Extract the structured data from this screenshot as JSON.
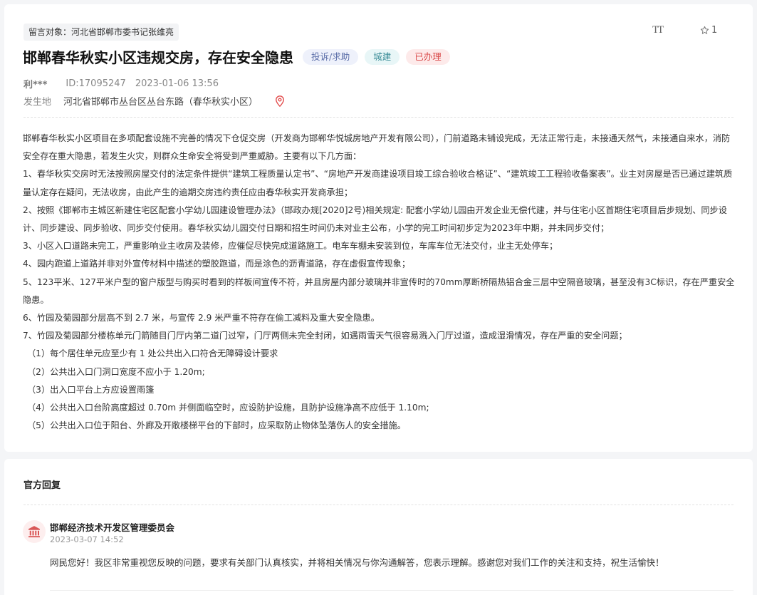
{
  "message": {
    "target_tag": "留言对象：河北省邯郸市委书记张维亮",
    "font_tool_label": "TT",
    "star_count": "1",
    "title": "邯郸春华秋实小区违规交房，存在安全隐患",
    "badges": [
      "投诉/求助",
      "城建",
      "已办理"
    ],
    "author": "利***",
    "post_id": "ID:17095247",
    "date": "2023-01-06 13:56",
    "location_label": "发生地",
    "location_value": "河北省邯郸市丛台区丛台东路（春华秋实小区）"
  },
  "content": {
    "paragraphs": [
      "邯郸春华秋实小区项目在多项配套设施不完善的情况下仓促交房（开发商为邯郸华悦城房地产开发有限公司），门前道路未铺设完成，无法正常行走，未接通天然气，未接通自来水，消防安全存在重大隐患，若发生火灾，则群众生命安全将受到严重威胁。主要有以下几方面：",
      "1、春华秋实交房时无法按照房屋交付的法定条件提供“建筑工程质量认定书”、“房地产开发商建设项目竣工综合验收合格证”、“建筑竣工工程验收备案表”。业主对房屋是否已通过建筑质量认定存在疑问，无法收房，由此产生的逾期交房违约责任应由春华秋实开发商承担；",
      "2、按照《邯郸市主城区新建住宅区配套小学幼儿园建设管理办法》（邯政办规[2020]2号)相关规定: 配套小学幼儿园由开发企业无偿代建，并与住宅小区首期住宅项目后步规划、同步设计、同步建设、同步验收、同步交付使用。春华秋实幼儿园交付日期和招生时间仍未对业主公布，小学的完工时间初步定为2023年中期，并未同步交付；",
      "3、小区入口道路未完工，严重影响业主收房及装修，应催促尽快完成道路施工。电车车棚未安装到位，车库车位无法交付，业主无处停车；",
      "4、园内跑道上道路并非对外宣传材料中描述的塑胶跑道，而是涂色的沥青道路，存在虚假宣传现象；",
      "5、123平米、127平米户型的窗户版型与购买时看到的样板间宣传不符，并且房屋内部分玻璃并非宣传时的70mm厚断桥隔热铝合金三层中空隔音玻璃，甚至没有3C标识，存在严重安全隐患。",
      "6、竹园及菊园部分层高不到 2.7 米，与宣传 2.9 米严重不符存在偷工减料及重大安全隐患。",
      "7、竹园及菊园部分楼栋单元门箭随目门厅内第二道门过窄，门厅两侧未完全封闭，如遇雨雪天气很容易溅入门厅过道，造成湿滑情况，存在严重的安全问题；"
    ],
    "sub_items": [
      "（1）每个居住单元应至少有 1 处公共出入口符合无障碍设计要求",
      "（2）公共出入口门洞口宽度不应小于 1.20m;",
      "（3）出入口平台上方应设置雨篷",
      "（4）公共出入口台阶高度超过 0.70m 并侧面临空时，应设防护设施，且防护设施净高不应低于 1.10m;",
      "（5）公共出入口位于阳台、外廊及开敞楼梯平台的下部时，应采取防止物体坠落伤人的安全措施。"
    ]
  },
  "reply": {
    "heading": "官方回复",
    "org_name": "邯郸经济技术开发区管理委员会",
    "date": "2023-03-07 14:52",
    "text": "网民您好！我区非常重视您反映的问题，要求有关部门认真核实，并将相关情况与你沟通解答，您表示理解。感谢您对我们工作的关注和支持，祝生活愉快！"
  },
  "colors": {
    "badge_blue": "#5b6ea8",
    "badge_cyan": "#3a8c97",
    "badge_red": "#d94a4a",
    "pin": "#e24a4a",
    "org_icon": "#d95656"
  },
  "icons": [
    "text-size-icon",
    "star-icon",
    "location-pin-icon",
    "government-building-icon"
  ]
}
